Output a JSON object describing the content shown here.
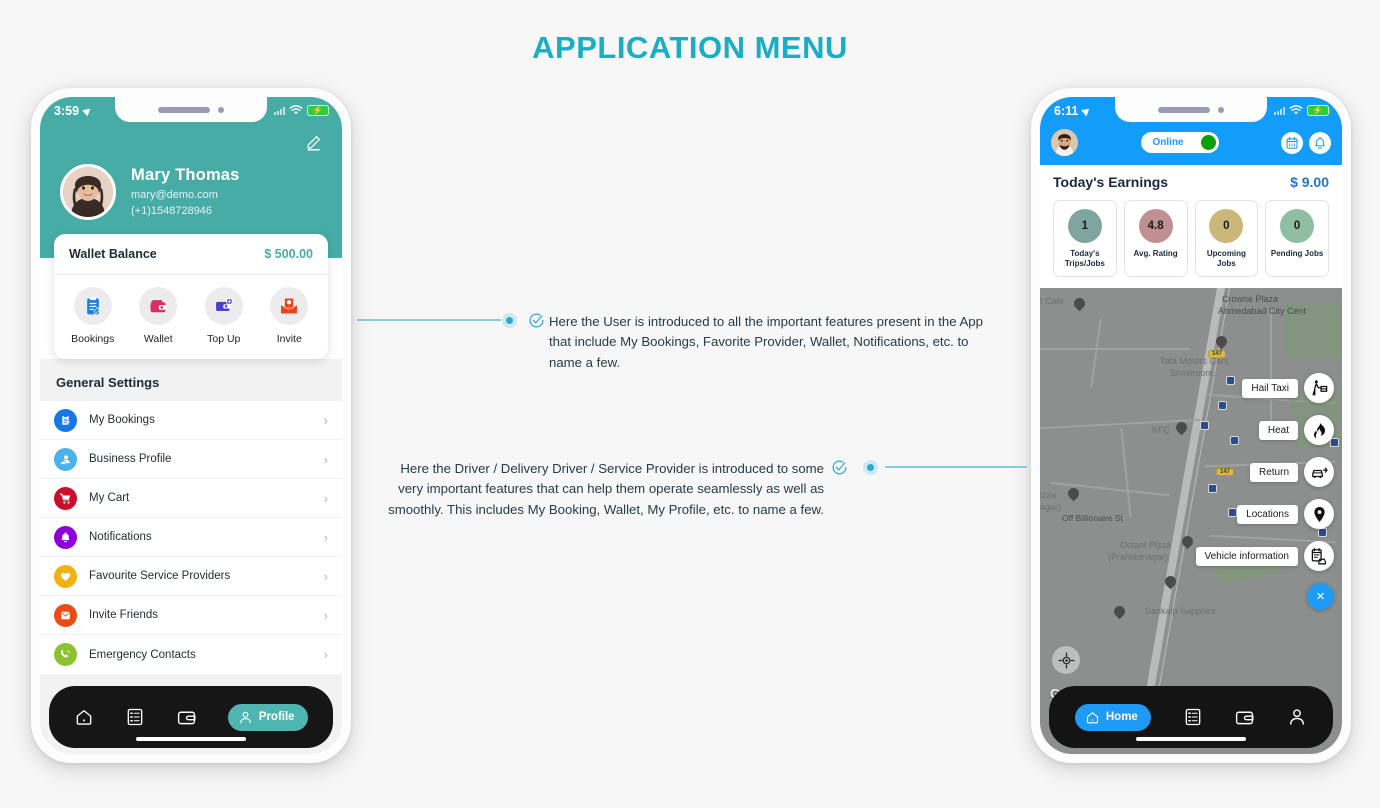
{
  "page": {
    "title": "APPLICATION MENU",
    "accent": "#18aec4"
  },
  "left_phone": {
    "theme_color": "#48aca6",
    "statusbar": {
      "time": "3:59",
      "location_icon": "location-arrow-icon",
      "wifi_icon": "wifi-icon",
      "battery_icon": "battery-charging-icon"
    },
    "edit_icon": "pencil-edit-icon",
    "profile": {
      "name": "Mary Thomas",
      "email": "mary@demo.com",
      "phone": "(+1)1548728946",
      "avatar": "user-avatar"
    },
    "wallet": {
      "label": "Wallet Balance",
      "amount": "$ 500.00",
      "actions": [
        {
          "label": "Bookings",
          "icon": "clipboard-check-icon",
          "color": "#1e7fe0"
        },
        {
          "label": "Wallet",
          "icon": "wallet-icon",
          "color": "#d82f64"
        },
        {
          "label": "Top Up",
          "icon": "wallet-plus-icon",
          "color": "#4b3fd0"
        },
        {
          "label": "Invite",
          "icon": "envelope-icon",
          "color": "#e8441a"
        }
      ]
    },
    "settings": {
      "section_title": "General Settings",
      "items": [
        {
          "label": "My Bookings",
          "icon": "clipboard-check-icon",
          "color": "#1677e8"
        },
        {
          "label": "Business Profile",
          "icon": "business-card-icon",
          "color": "#4cb2e8"
        },
        {
          "label": "My Cart",
          "icon": "shopping-cart-icon",
          "color": "#c8102b"
        },
        {
          "label": "Notifications",
          "icon": "bell-icon",
          "color": "#8e00d6"
        },
        {
          "label": "Favourite Service Providers",
          "icon": "heart-icon",
          "color": "#efb012"
        },
        {
          "label": "Invite Friends",
          "icon": "envelope-icon",
          "color": "#ec4a16"
        },
        {
          "label": "Emergency Contacts",
          "icon": "phone-call-icon",
          "color": "#8cc132"
        }
      ],
      "chevron": "›"
    },
    "bottom_nav": {
      "items": [
        {
          "label": "",
          "icon": "home-icon",
          "active": false
        },
        {
          "label": "",
          "icon": "task-list-icon",
          "active": false
        },
        {
          "label": "",
          "icon": "wallet-icon",
          "active": false
        },
        {
          "label": "Profile",
          "icon": "user-icon",
          "active": true
        }
      ],
      "active_color": "#4fb5b0"
    }
  },
  "right_phone": {
    "theme_color": "#149cfb",
    "statusbar": {
      "time": "6:11",
      "location_icon": "location-arrow-icon",
      "wifi_icon": "wifi-icon",
      "battery_icon": "battery-charging-icon"
    },
    "header": {
      "avatar": "driver-avatar",
      "status_label": "Online",
      "status_color": "#0aa00a",
      "calendar_icon": "calendar-icon",
      "bell_icon": "bell-icon"
    },
    "earnings": {
      "title": "Today's Earnings",
      "amount": "$ 9.00",
      "stats": [
        {
          "value": "1",
          "label": "Today's\nTrips/Jobs",
          "color": "#7fa5a1"
        },
        {
          "value": "4.8",
          "label": "Avg. Rating",
          "color": "#c08f91"
        },
        {
          "value": "0",
          "label": "Upcoming Jobs",
          "color": "#cbb878"
        },
        {
          "value": "0",
          "label": "Pending Jobs",
          "color": "#8fbfa0"
        }
      ]
    },
    "map": {
      "labels": [
        "Crowne Plaza",
        "Ahmedabad City Cent",
        "Tata Motors Cars",
        "Showroom...",
        "Off Billionaire St",
        "Octant Pizza",
        "(Prahladnagar)",
        "Sankalp Sapphire",
        "KFC",
        "t Cafe",
        "izza",
        "agar)"
      ],
      "highway_marker": "147",
      "attribution": "Google",
      "locate_icon": "my-location-icon"
    },
    "actions": [
      {
        "label": "Hail Taxi",
        "icon": "hail-taxi-icon"
      },
      {
        "label": "Heat",
        "icon": "flame-icon"
      },
      {
        "label": "Return",
        "icon": "car-return-icon"
      },
      {
        "label": "Locations",
        "icon": "map-pin-icon"
      },
      {
        "label": "Vehicle information",
        "icon": "vehicle-info-icon"
      }
    ],
    "close_button": "×",
    "bottom_nav": {
      "items": [
        {
          "label": "Home",
          "icon": "home-icon",
          "active": true
        },
        {
          "label": "",
          "icon": "task-list-icon",
          "active": false
        },
        {
          "label": "",
          "icon": "wallet-icon",
          "active": false
        },
        {
          "label": "",
          "icon": "user-icon",
          "active": false
        }
      ],
      "active_color": "#1d9bf6"
    }
  },
  "annotations": [
    {
      "id": "user-annotation",
      "text": "Here the User is introduced to all the important features present in the App that include My Bookings, Favorite Provider, Wallet, Notifications, etc. to name a few.",
      "check_icon": "check-circle-icon"
    },
    {
      "id": "driver-annotation",
      "text": "Here the Driver / Delivery Driver / Service Provider is introduced to some very important features that can help them operate seamlessly as well as smoothly. This includes My Booking, Wallet, My Profile, etc. to name a few.",
      "check_icon": "check-circle-icon"
    }
  ]
}
